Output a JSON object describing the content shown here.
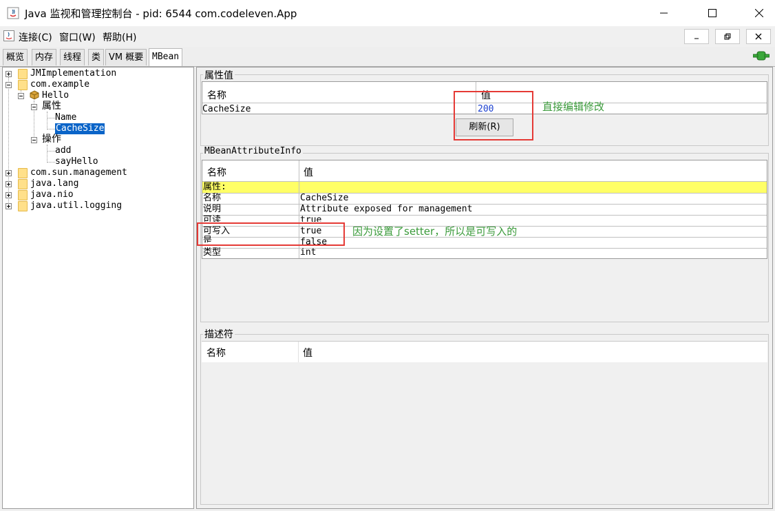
{
  "window": {
    "title": "Java 监视和管理控制台 - pid: 6544 com.codeleven.App"
  },
  "menu": {
    "items": [
      "连接(C)",
      "窗口(W)",
      "帮助(H)"
    ]
  },
  "tabs": [
    "概览",
    "内存",
    "线程",
    "类",
    "VM 概要",
    "MBean"
  ],
  "tree": {
    "nodes": {
      "jmimpl": "JMImplementation",
      "com_example": "com.example",
      "hello": "Hello",
      "attributes": "属性",
      "name": "Name",
      "cachesize": "CacheSize",
      "operations": "操作",
      "add": "add",
      "sayhello": "sayHello",
      "com_sun": "com.sun.management",
      "java_lang": "java.lang",
      "java_nio": "java.nio",
      "java_util_logging": "java.util.logging"
    }
  },
  "attr_values": {
    "title": "属性值",
    "col_name": "名称",
    "col_value": "值",
    "row_name": "CacheSize",
    "row_value": "200",
    "refresh_button": "刷新(R)",
    "annotation": "直接编辑修改"
  },
  "attr_info": {
    "title": "MBeanAttributeInfo",
    "col_name": "名称",
    "col_value": "值",
    "rows": [
      {
        "name": "属性:",
        "value": ""
      },
      {
        "name": "名称",
        "value": "CacheSize"
      },
      {
        "name": "说明",
        "value": "Attribute exposed for management"
      },
      {
        "name": "可读",
        "value": "true"
      },
      {
        "name": "可写入",
        "value": "true"
      },
      {
        "name": "是",
        "value": "false"
      },
      {
        "name": "类型",
        "value": "int"
      }
    ],
    "annotation": "因为设置了setter，所以是可写入的"
  },
  "descriptor": {
    "title": "描述符",
    "col_name": "名称",
    "col_value": "值"
  },
  "colors": {
    "highlight_row": "#ffff66",
    "annotation_box": "#e53935",
    "annotation_text": "#3a9a3a",
    "value_text": "#1a3fcf",
    "selection": "#0a64c8"
  }
}
